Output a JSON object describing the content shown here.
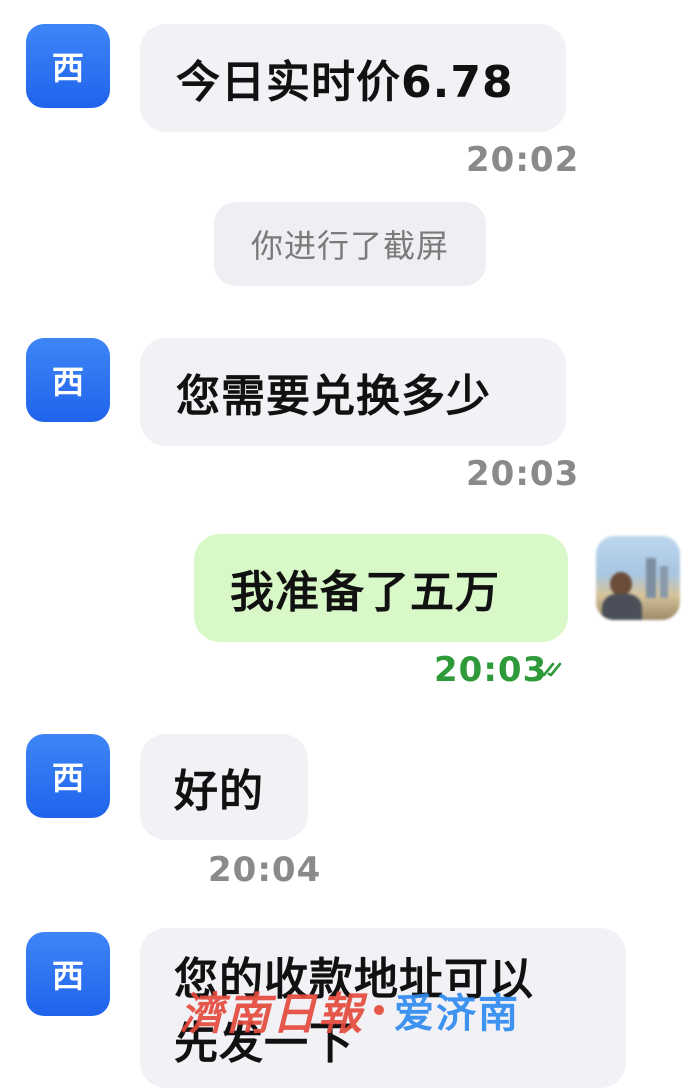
{
  "contact": {
    "avatar_char": "西"
  },
  "messages": [
    {
      "text": "今日实时价6.78",
      "time": "20:02"
    },
    {
      "system": "你进行了截屏"
    },
    {
      "text": "您需要兑换多少",
      "time": "20:03"
    },
    {
      "text": "我准备了五万",
      "time": "20:03",
      "status_icon": "double-check-icon"
    },
    {
      "text": "好的",
      "time": "20:04"
    },
    {
      "text_line1": "您的收款地址可以",
      "text_line2": "先发一下"
    }
  ],
  "watermark": {
    "newspaper": "濟南日報",
    "app": "爱济南"
  },
  "colors": {
    "incoming_bubble": "#f2f2f6",
    "outgoing_bubble": "#d9f8c7",
    "avatar_blue": "#2b6ff0",
    "read_green": "#2e9a3a",
    "timestamp_gray": "#8a8a8a"
  }
}
